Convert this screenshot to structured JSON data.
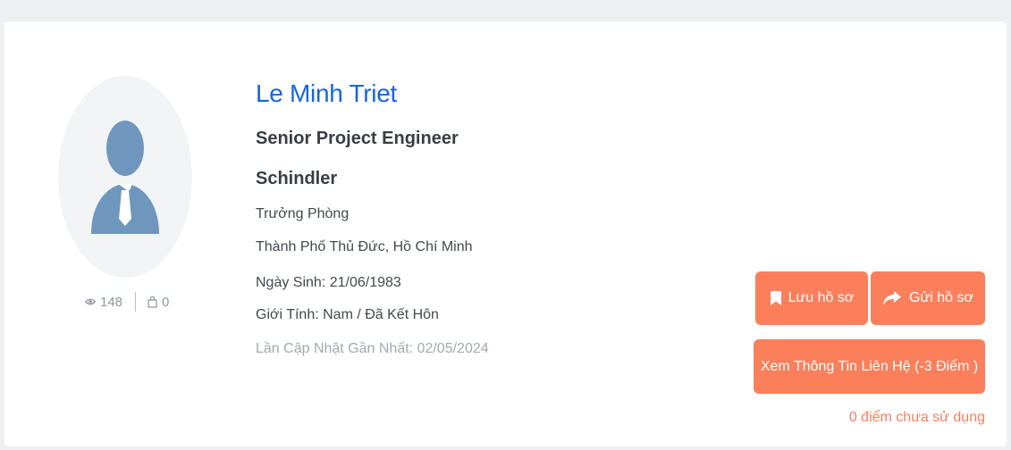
{
  "profile": {
    "name": "Le Minh Triet",
    "title": "Senior Project Engineer",
    "company": "Schindler",
    "position": "Trưởng Phòng",
    "location": "Thành Phố Thủ Đức, Hồ Chí Minh",
    "birthday": "Ngày Sinh: 21/06/1983",
    "gender_marital": "Giới Tính: Nam / Đã Kết Hôn",
    "last_updated": "Lần Cập Nhật Gần Nhất: 02/05/2024"
  },
  "stats": {
    "views": "148",
    "saves": "0",
    "views_icon": "eye-icon",
    "saves_icon": "bag-icon"
  },
  "actions": {
    "save_label": "Lưu hồ sơ",
    "save_icon": "bookmark-icon",
    "send_label": "Gửi hồ sơ",
    "send_icon": "share-arrow-icon",
    "contact_label": "Xem Thông Tin Liên Hệ (-3 Điểm )",
    "points_note": "0 điểm chưa sử dụng"
  },
  "colors": {
    "accent": "#fb7f5b",
    "name_link": "#1565e5",
    "avatar_figure": "#6f97bd",
    "avatar_bg": "#f2f3f4"
  }
}
